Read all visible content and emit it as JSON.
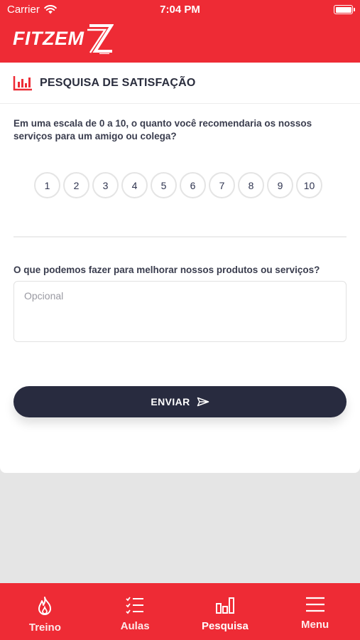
{
  "status_bar": {
    "carrier": "Carrier",
    "time": "7:04 PM"
  },
  "app": {
    "logo_text": "FITZEM",
    "brand_color": "#ee2b35"
  },
  "card": {
    "title": "PESQUISA DE SATISFAÇÃO",
    "question1": "Em uma escala de 0 a 10, o quanto você recomendaria os nossos serviços para um amigo ou colega?",
    "scale": [
      "1",
      "2",
      "3",
      "4",
      "5",
      "6",
      "7",
      "8",
      "9",
      "10"
    ],
    "question2": "O que podemos fazer para melhorar nossos produtos ou serviços?",
    "feedback_placeholder": "Opcional",
    "feedback_value": "",
    "send_label": "ENVIAR"
  },
  "tabs": [
    {
      "label": "Treino",
      "icon": "flame-icon",
      "active": false
    },
    {
      "label": "Aulas",
      "icon": "checklist-icon",
      "active": false
    },
    {
      "label": "Pesquisa",
      "icon": "bar-chart-icon",
      "active": true
    },
    {
      "label": "Menu",
      "icon": "hamburger-menu-icon",
      "active": false
    }
  ]
}
